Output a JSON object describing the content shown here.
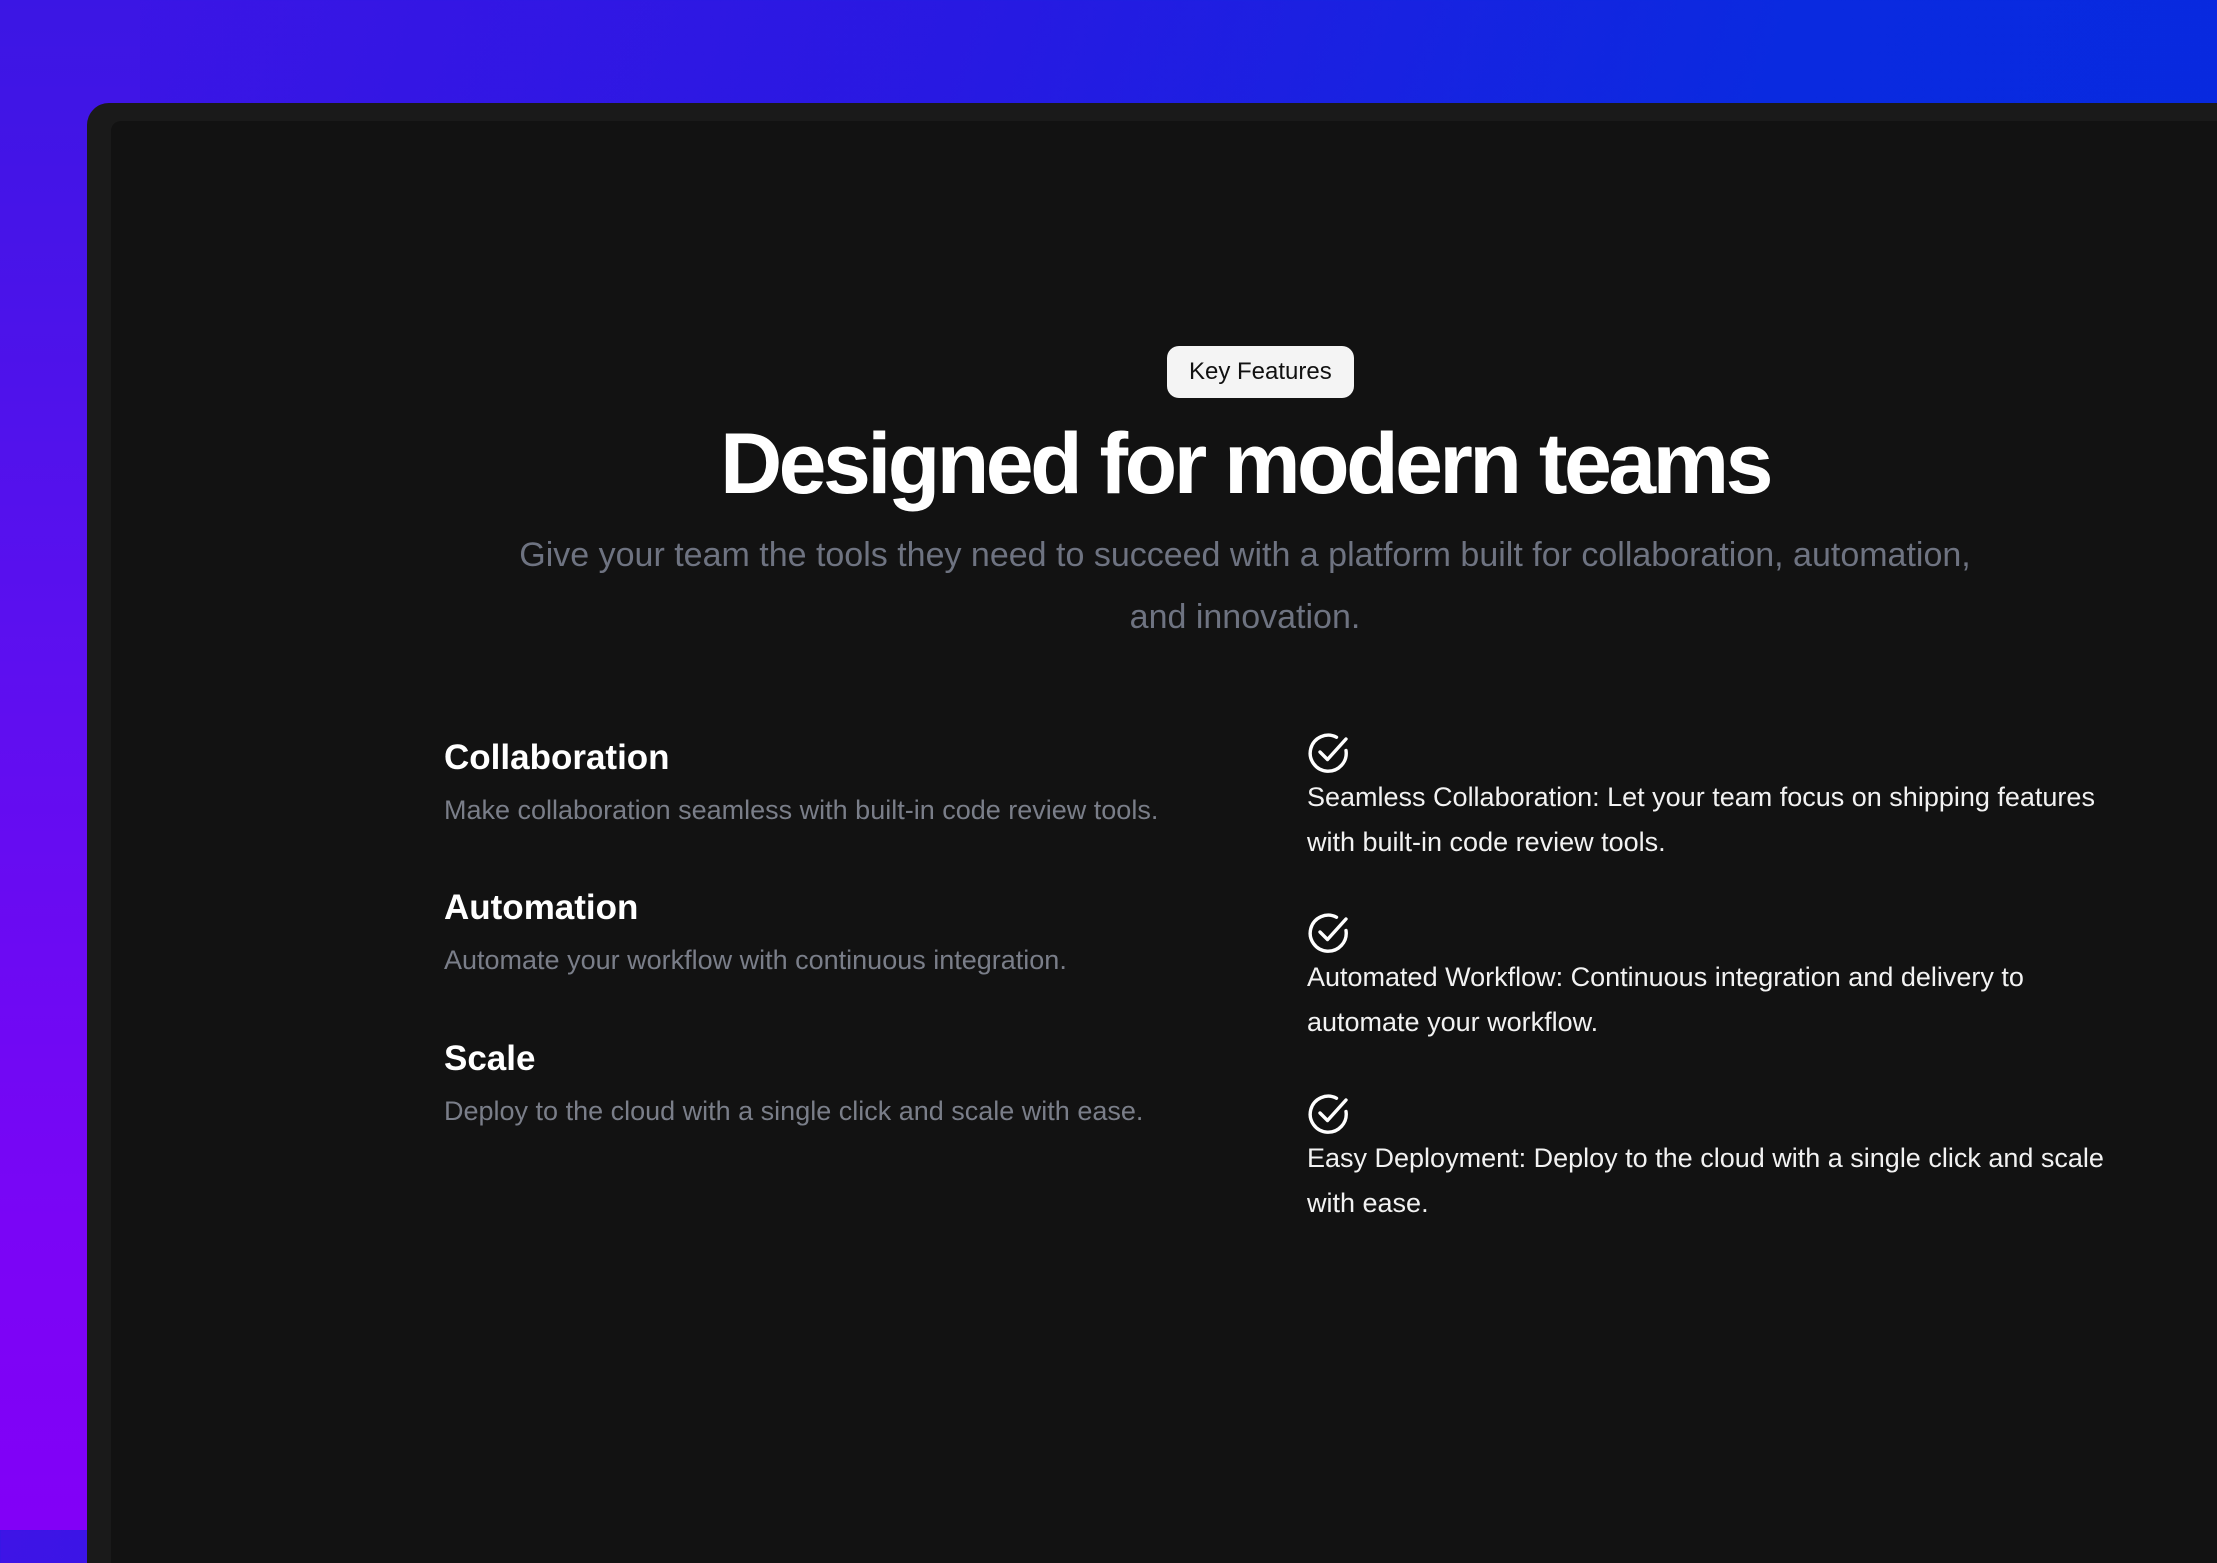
{
  "badge": {
    "label": "Key Features"
  },
  "hero": {
    "title": "Designed for modern teams",
    "subtitle": "Give your team the tools they need to succeed with a platform built for collaboration, automation, and innovation."
  },
  "features": [
    {
      "title": "Collaboration",
      "description": "Make collaboration seamless with built-in code review tools."
    },
    {
      "title": "Automation",
      "description": "Automate your workflow with continuous integration."
    },
    {
      "title": "Scale",
      "description": "Deploy to the cloud with a single click and scale with ease."
    }
  ],
  "checklist": [
    {
      "icon": "check-circle-icon",
      "text": "Seamless Collaboration: Let your team focus on shipping features with built-in code review tools."
    },
    {
      "icon": "check-circle-icon",
      "text": "Automated Workflow: Continuous integration and delivery to automate your workflow."
    },
    {
      "icon": "check-circle-icon",
      "text": "Easy Deployment: Deploy to the cloud with a single click and scale with ease."
    }
  ],
  "colors": {
    "background_gradient_start": "#3e14e6",
    "background_gradient_end": "#0528de",
    "background_left_bottom": "#8200f7",
    "window": "#1a1a1a",
    "panel": "#121212",
    "heading": "#ffffff",
    "muted_text": "#6e7381"
  }
}
